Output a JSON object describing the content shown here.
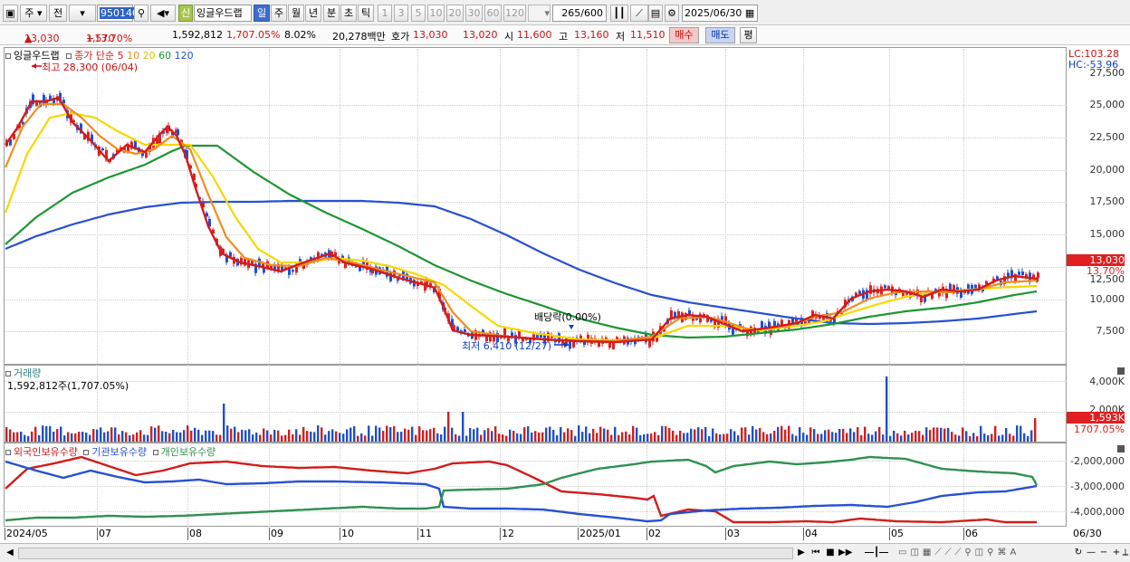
{
  "toolbar": {
    "period_label": "주",
    "prev_label": "전",
    "code": "950140",
    "badge": "신",
    "name": "잉글우드랩",
    "intervals": [
      "일",
      "주",
      "월",
      "년",
      "분",
      "초",
      "틱"
    ],
    "intervals_active": 0,
    "numbers": [
      "1",
      "3",
      "5",
      "10",
      "20",
      "30",
      "60",
      "120"
    ],
    "count": "265",
    "count_total": "/600",
    "date": "2025/06/30"
  },
  "quote": {
    "price": "13,030",
    "arrow": "▲",
    "change": "1,570",
    "change_pct": "+13.70%",
    "volume": "1,592,812",
    "volume_ratio": "1,707.05%",
    "turnover": "8.02%",
    "amount": "20,278백만",
    "ask_label": "호가",
    "ask1": "13,030",
    "ask2": "13,020",
    "open_label": "시",
    "open": "11,600",
    "high_label": "고",
    "high": "13,160",
    "low_label": "저",
    "low": "11,510",
    "buy_label": "매수",
    "sell_label": "매도",
    "eval_label": "평"
  },
  "price_panel": {
    "legend_name": "잉글우드랩",
    "legend_ma": "종가 단순",
    "ma_periods": [
      "5",
      "10",
      "20",
      "60",
      "120"
    ],
    "high_note": "최고 28,300 (06/04)",
    "low_note": "최저 6,410 (12/27)",
    "dividend_note": "배당락(0.00%)",
    "lc": "LC:103.28",
    "hc": "HC:-53.96",
    "y_ticks": [
      "27,500",
      "25,000",
      "22,500",
      "20,000",
      "17,500",
      "15,000",
      "12,500",
      "10,000",
      "7,500"
    ],
    "last_price_tag": "13,030",
    "last_pct_tag": "13.70%"
  },
  "volume_panel": {
    "title": "거래량",
    "info": "1,592,812주(1,707.05%)",
    "y_ticks": [
      "4,000K",
      "2,000K"
    ],
    "tag": "1,593K",
    "tag_pct": "1707.05%"
  },
  "holders_panel": {
    "legend": [
      "외국인보유수량",
      "기관보유수량",
      "개인보유수량"
    ],
    "y_ticks": [
      "-2,000,000",
      "-3,000,000",
      "-4,000,000"
    ]
  },
  "x_axis": [
    "2024/05",
    "07",
    "08",
    "09",
    "10",
    "11",
    "12",
    "2025/01",
    "02",
    "03",
    "04",
    "05",
    "06",
    "06/30"
  ],
  "colors": {
    "ma5": "#d21c1c",
    "ma10": "#f08c1e",
    "ma20": "#f5d800",
    "ma60": "#1e9632",
    "ma120": "#2850d2",
    "foreign": "#d21c1c",
    "institution": "#2850d2",
    "individual": "#2e9150"
  }
}
